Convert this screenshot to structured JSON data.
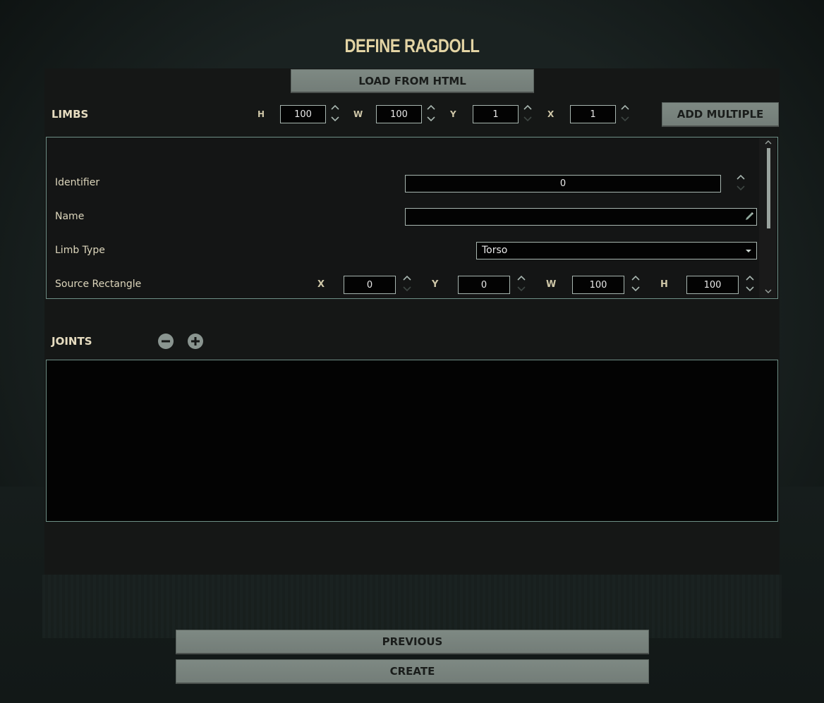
{
  "window": {
    "title": "DEFINE RAGDOLL"
  },
  "toolbar": {
    "load_label": "LOAD FROM HTML"
  },
  "limbs": {
    "label": "LIMBS",
    "h_label": "H",
    "h_value": "100",
    "w_label": "W",
    "w_value": "100",
    "y_label": "Y",
    "y_value": "1",
    "x_label": "X",
    "x_value": "1",
    "add_multiple_label": "ADD MULTIPLE"
  },
  "limb_props": {
    "identifier_label": "Identifier",
    "identifier_value": "0",
    "name_label": "Name",
    "name_value": "",
    "limb_type_label": "Limb Type",
    "limb_type_value": "Torso",
    "source_rect_label": "Source Rectangle",
    "rect_x_label": "X",
    "rect_x_value": "0",
    "rect_y_label": "Y",
    "rect_y_value": "0",
    "rect_w_label": "W",
    "rect_w_value": "100",
    "rect_h_label": "H",
    "rect_h_value": "100"
  },
  "joints": {
    "label": "JOINTS"
  },
  "footer": {
    "previous_label": "PREVIOUS",
    "create_label": "CREATE"
  },
  "icons": {
    "pencil": "pencil-icon",
    "dropdown": "chevron-down-icon",
    "minus": "minus-circle-icon",
    "plus": "plus-circle-icon",
    "spin_up": "chevron-up-icon",
    "spin_down": "chevron-down-icon"
  },
  "colors": {
    "title": "#e3d4a4",
    "button_bg": "#7e8983",
    "input_border": "#a8b6b0",
    "box_border": "#6e8f86"
  }
}
